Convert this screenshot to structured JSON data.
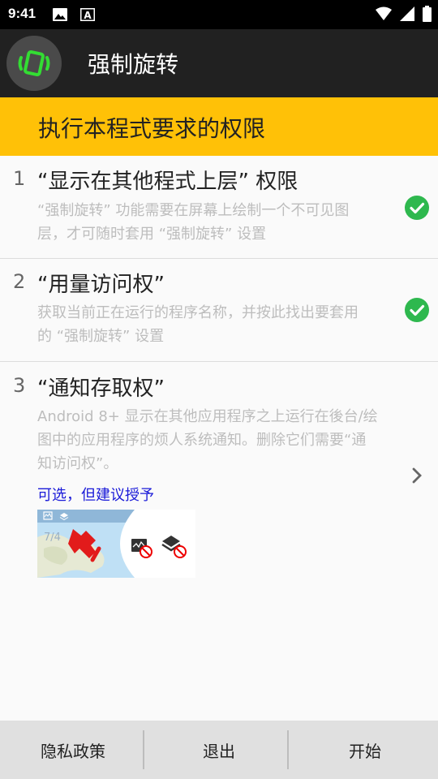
{
  "status_bar": {
    "time": "9:41"
  },
  "app_bar": {
    "title": "强制旋转",
    "logo_icon": "rotate-phone-icon",
    "accent": "#33dd33"
  },
  "banner": {
    "text": "执行本程式要求的权限",
    "color": "#ffc107"
  },
  "permissions": [
    {
      "number": "1",
      "title": "“显示在其他程式上层” 权限",
      "desc_line1": "“强制旋转” 功能需要在屏幕上绘制一个不可见图",
      "desc_line2": "层，才可随时套用 “强制旋转” 设置",
      "status_icon": "check-circle-icon"
    },
    {
      "number": "2",
      "title": "“用量访问权”",
      "desc_line1": "获取当前正在运行的程序名称，并按此找出要套用",
      "desc_line2": "的 “强制旋转” 设置",
      "status_icon": "check-circle-icon"
    },
    {
      "number": "3",
      "title": "“通知存取权”",
      "desc_line1": "Android 8+ 显示在其他应用程序之上运行在後台/绘",
      "desc_line2": "图中的应用程序的烦人系统通知。删除它们需要“通",
      "desc_line3": "知访问权”。",
      "optional_note": "可选，但建议授予",
      "preview_date": "7/4",
      "status_icon": "chevron-right-icon"
    }
  ],
  "bottom_bar": {
    "privacy": "隐私政策",
    "exit": "退出",
    "start": "开始"
  }
}
